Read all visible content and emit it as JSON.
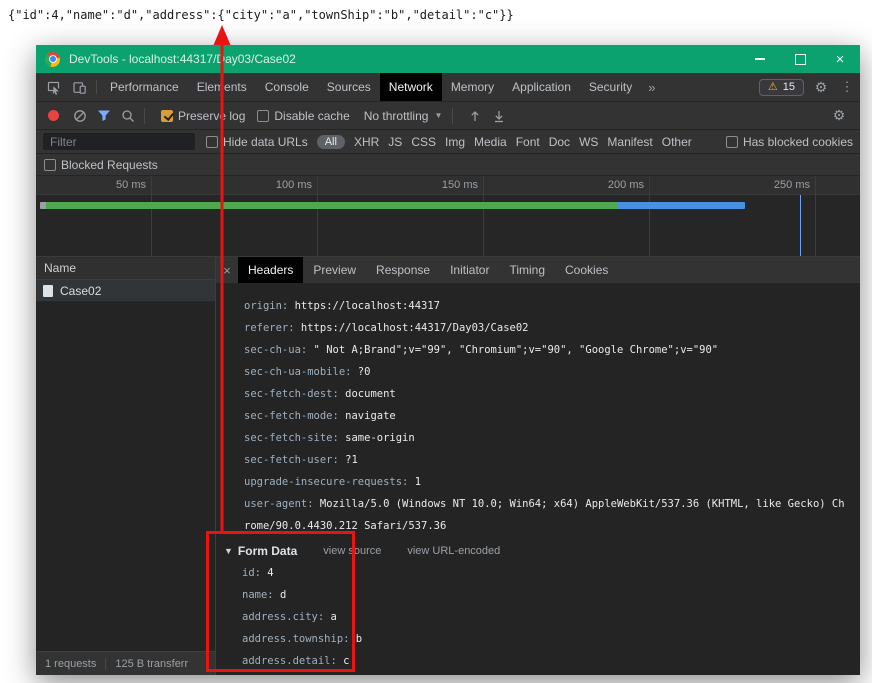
{
  "annotation": {
    "json_text": "{\"id\":4,\"name\":\"d\",\"address\":{\"city\":\"a\",\"townShip\":\"b\",\"detail\":\"c\"}}"
  },
  "titlebar": {
    "title": "DevTools - localhost:44317/Day03/Case02"
  },
  "icons": {
    "close_window": "×",
    "gear": "⚙",
    "kebab": "⋮",
    "warning": "⚠",
    "overflow": "»",
    "caret_down": "▼",
    "form_disclosure": "▼",
    "close_details": "×"
  },
  "main_tabs": {
    "items": [
      "Performance",
      "Elements",
      "Console",
      "Sources",
      "Network",
      "Memory",
      "Application",
      "Security"
    ],
    "active": "Network",
    "issues_count": "15"
  },
  "network_toolbar": {
    "preserve_log_label": "Preserve log",
    "disable_cache_label": "Disable cache",
    "throttling_value": "No throttling"
  },
  "filter_bar": {
    "filter_placeholder": "Filter",
    "hide_data_urls_label": "Hide data URLs",
    "type_filters": [
      "All",
      "XHR",
      "JS",
      "CSS",
      "Img",
      "Media",
      "Font",
      "Doc",
      "WS",
      "Manifest",
      "Other"
    ],
    "active_type_filter": "All",
    "has_blocked_cookies_label": "Has blocked cookies",
    "blocked_requests_label": "Blocked Requests"
  },
  "timeline": {
    "tick_labels": [
      "50 ms",
      "100 ms",
      "150 ms",
      "200 ms",
      "250 ms"
    ]
  },
  "requests_panel": {
    "column_header": "Name",
    "rows": [
      {
        "name": "Case02"
      }
    ],
    "summary": {
      "requests": "1 requests",
      "transferred": "125 B transferr"
    }
  },
  "details_panel": {
    "tabs": [
      "Headers",
      "Preview",
      "Response",
      "Initiator",
      "Timing",
      "Cookies"
    ],
    "active_tab": "Headers",
    "request_headers": [
      {
        "name": "origin:",
        "value": "https://localhost:44317"
      },
      {
        "name": "referer:",
        "value": "https://localhost:44317/Day03/Case02"
      },
      {
        "name": "sec-ch-ua:",
        "value": "\" Not A;Brand\";v=\"99\", \"Chromium\";v=\"90\", \"Google Chrome\";v=\"90\""
      },
      {
        "name": "sec-ch-ua-mobile:",
        "value": "?0"
      },
      {
        "name": "sec-fetch-dest:",
        "value": "document"
      },
      {
        "name": "sec-fetch-mode:",
        "value": "navigate"
      },
      {
        "name": "sec-fetch-site:",
        "value": "same-origin"
      },
      {
        "name": "sec-fetch-user:",
        "value": "?1"
      },
      {
        "name": "upgrade-insecure-requests:",
        "value": "1"
      },
      {
        "name": "user-agent:",
        "value": "Mozilla/5.0 (Windows NT 10.0; Win64; x64) AppleWebKit/537.36 (KHTML, like Gecko) Chrome/90.0.4430.212 Safari/537.36"
      }
    ],
    "form_data": {
      "title": "Form Data",
      "view_source_label": "view source",
      "view_url_encoded_label": "view URL-encoded",
      "params": [
        {
          "name": "id:",
          "value": "4"
        },
        {
          "name": "name:",
          "value": "d"
        },
        {
          "name": "address.city:",
          "value": "a"
        },
        {
          "name": "address.township:",
          "value": "b"
        },
        {
          "name": "address.detail:",
          "value": "c"
        }
      ]
    }
  },
  "colors": {
    "titlebar_green": "#0ca26f",
    "annotation_red": "#e81414",
    "checkbox_checked_orange": "#d79d3a",
    "timeline_green": "#4fa74f",
    "timeline_blue": "#4a90e2"
  }
}
